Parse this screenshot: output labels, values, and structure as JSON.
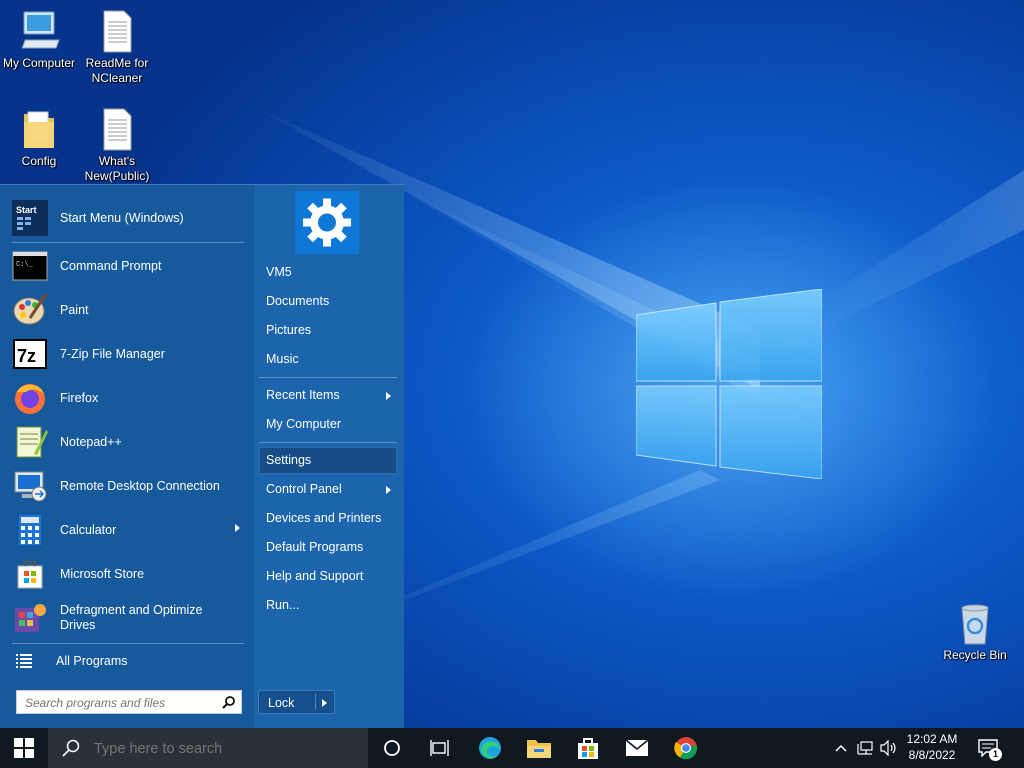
{
  "desktop": {
    "icons": [
      {
        "label_line1": "My Computer",
        "label_line2": ""
      },
      {
        "label_line1": "ReadMe for",
        "label_line2": "NCleaner"
      },
      {
        "label_line1": "Config",
        "label_line2": ""
      },
      {
        "label_line1": "What's",
        "label_line2": "New(Public)"
      },
      {
        "label_line1": "Recycle Bin",
        "label_line2": ""
      }
    ]
  },
  "start_menu": {
    "pinned": [
      {
        "label": "Start Menu (Windows)",
        "icon": "start-menu-icon"
      },
      {
        "label": "Command Prompt",
        "icon": "command-prompt-icon"
      },
      {
        "label": "Paint",
        "icon": "paint-icon"
      },
      {
        "label": "7-Zip File Manager",
        "icon": "7zip-icon"
      },
      {
        "label": "Firefox",
        "icon": "firefox-icon"
      },
      {
        "label": "Notepad++",
        "icon": "notepadpp-icon"
      },
      {
        "label": "Remote Desktop Connection",
        "icon": "remote-desktop-icon"
      },
      {
        "label": "Calculator",
        "icon": "calculator-icon"
      },
      {
        "label": "Microsoft Store",
        "icon": "store-icon"
      },
      {
        "label_line1": "Defragment and Optimize",
        "label_line2": "Drives",
        "icon": "defrag-icon"
      }
    ],
    "start_icon_text": "Start",
    "cmd_icon_text": "C:\\_",
    "zip_icon_text": "7z",
    "all_programs": "All Programs",
    "search_placeholder": "Search programs and files",
    "right": {
      "items": [
        "VM5",
        "Documents",
        "Pictures",
        "Music",
        "Recent Items",
        "My Computer",
        "Settings",
        "Control Panel",
        "Devices and Printers",
        "Default Programs",
        "Help and Support",
        "Run..."
      ],
      "lock": "Lock"
    }
  },
  "taskbar": {
    "search_placeholder": "Type here to search",
    "time": "12:02 AM",
    "date": "8/8/2022",
    "notification_count": "1"
  },
  "colors": {
    "menu_bg": "#1b5fa3",
    "taskbar_bg": "#101820",
    "accent": "#0078d7"
  }
}
